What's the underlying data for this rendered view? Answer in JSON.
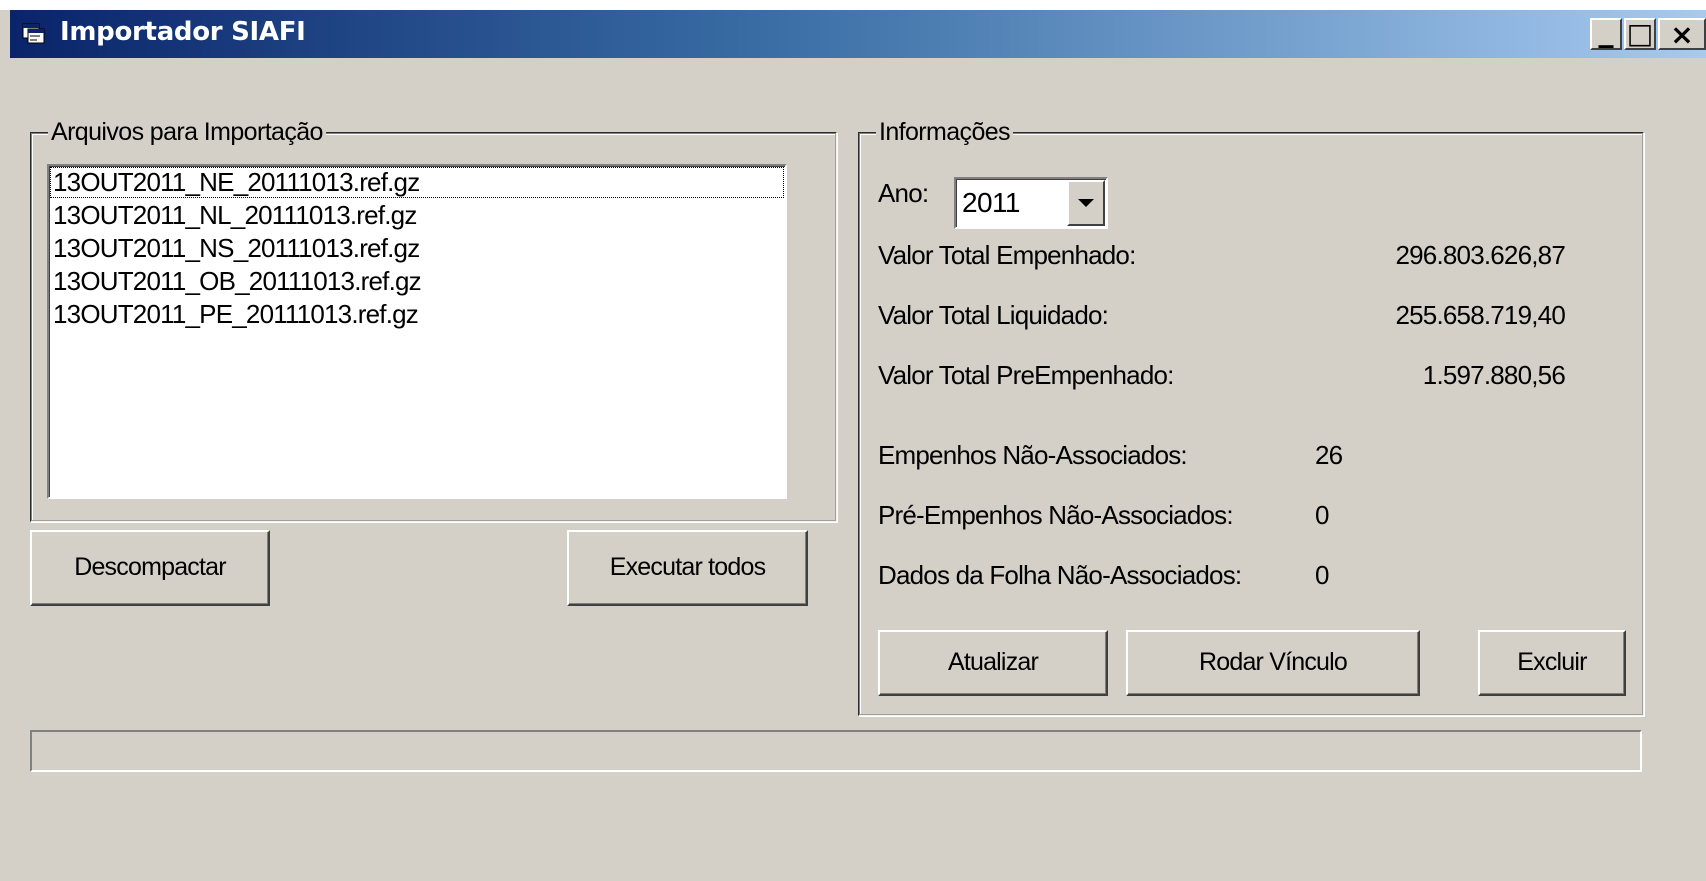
{
  "window": {
    "title": "Importador SIAFI",
    "minimize_glyph": "_",
    "maximize_glyph": "□",
    "close_glyph": "×",
    "icon": "app-window-icon"
  },
  "files_group": {
    "label": "Arquivos para Importação",
    "files": [
      "13OUT2011_NE_20111013.ref.gz",
      "13OUT2011_NL_20111013.ref.gz",
      "13OUT2011_NS_20111013.ref.gz",
      "13OUT2011_OB_20111013.ref.gz",
      "13OUT2011_PE_20111013.ref.gz"
    ]
  },
  "buttons": {
    "descompactar": "Descompactar",
    "executar_todos": "Executar todos",
    "atualizar": "Atualizar",
    "rodar_vinculo": "Rodar Vínculo",
    "excluir": "Excluir"
  },
  "info_group": {
    "label": "Informações",
    "ano_label": "Ano:",
    "ano_value": "2011",
    "valor_total_empenhado_label": "Valor Total Empenhado:",
    "valor_total_empenhado_value": "296.803.626,87",
    "valor_total_liquidado_label": "Valor Total Liquidado:",
    "valor_total_liquidado_value": "255.658.719,40",
    "valor_total_preempenhado_label": "Valor Total PreEmpenhado:",
    "valor_total_preempenhado_value": "1.597.880,56",
    "empenhos_nao_associados_label": "Empenhos Não-Associados:",
    "empenhos_nao_associados_value": "26",
    "pre_empenhos_nao_associados_label": "Pré-Empenhos Não-Associados:",
    "pre_empenhos_nao_associados_value": "0",
    "dados_folha_nao_associados_label": "Dados da Folha Não-Associados:",
    "dados_folha_nao_associados_value": "0"
  },
  "progress": {
    "value": 0
  },
  "colors": {
    "titlebar_start": "#0a246a",
    "titlebar_end": "#a6caf0",
    "face": "#d4d0c8"
  }
}
